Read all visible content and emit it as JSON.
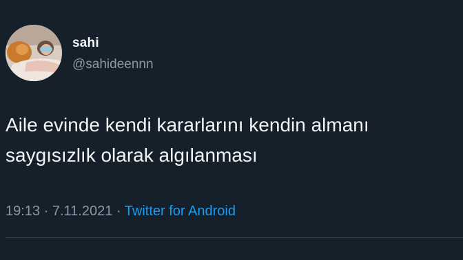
{
  "user": {
    "display_name": "sahi",
    "handle": "@sahideennn"
  },
  "tweet": {
    "lines": [
      "Aile evinde kendi kararlarını kendin almanı",
      "saygısızlık olarak algılanması"
    ],
    "time": "19:13",
    "date": "7.11.2021",
    "separator": "·",
    "source": "Twitter for Android"
  },
  "colors": {
    "background": "#15202b",
    "text": "#f2f4f5",
    "muted": "#8b98a5",
    "link": "#1d9bf0"
  },
  "icons": {
    "avatar": "profile-photo"
  }
}
